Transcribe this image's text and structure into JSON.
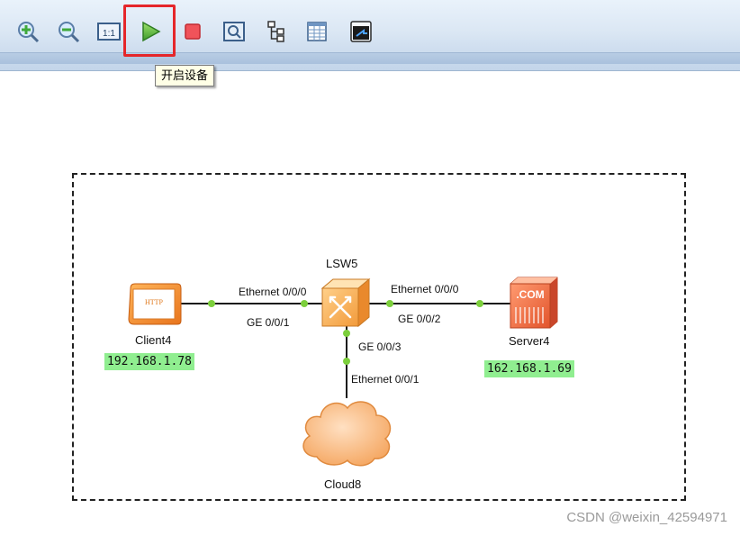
{
  "toolbar": {
    "buttons": [
      {
        "name": "zoom-in-icon"
      },
      {
        "name": "zoom-out-icon"
      },
      {
        "name": "actual-size-icon",
        "label": "1:1"
      },
      {
        "name": "start-device-icon"
      },
      {
        "name": "stop-device-icon"
      },
      {
        "name": "capture-icon"
      },
      {
        "name": "topology-icon"
      },
      {
        "name": "grid-icon"
      },
      {
        "name": "console-icon"
      }
    ],
    "tooltip": "开启设备",
    "highlight_color": "#e5262a"
  },
  "topology": {
    "switch": {
      "name": "LSW5"
    },
    "client": {
      "name": "Client4",
      "ip": "192.168.1.78",
      "badge": "HTTP"
    },
    "server": {
      "name": "Server4",
      "ip": "162.168.1.69",
      "badge": ".COM"
    },
    "cloud": {
      "name": "Cloud8"
    },
    "ports": {
      "client_eth": "Ethernet 0/0/0",
      "switch_ge1": "GE 0/0/1",
      "server_eth": "Ethernet 0/0/0",
      "switch_ge2": "GE 0/0/2",
      "switch_ge3": "GE 0/0/3",
      "cloud_eth": "Ethernet 0/0/1"
    },
    "link_point_color": "#7ccf3c",
    "ip_highlight_color": "#90ee90"
  },
  "watermark": "CSDN @weixin_42594971"
}
